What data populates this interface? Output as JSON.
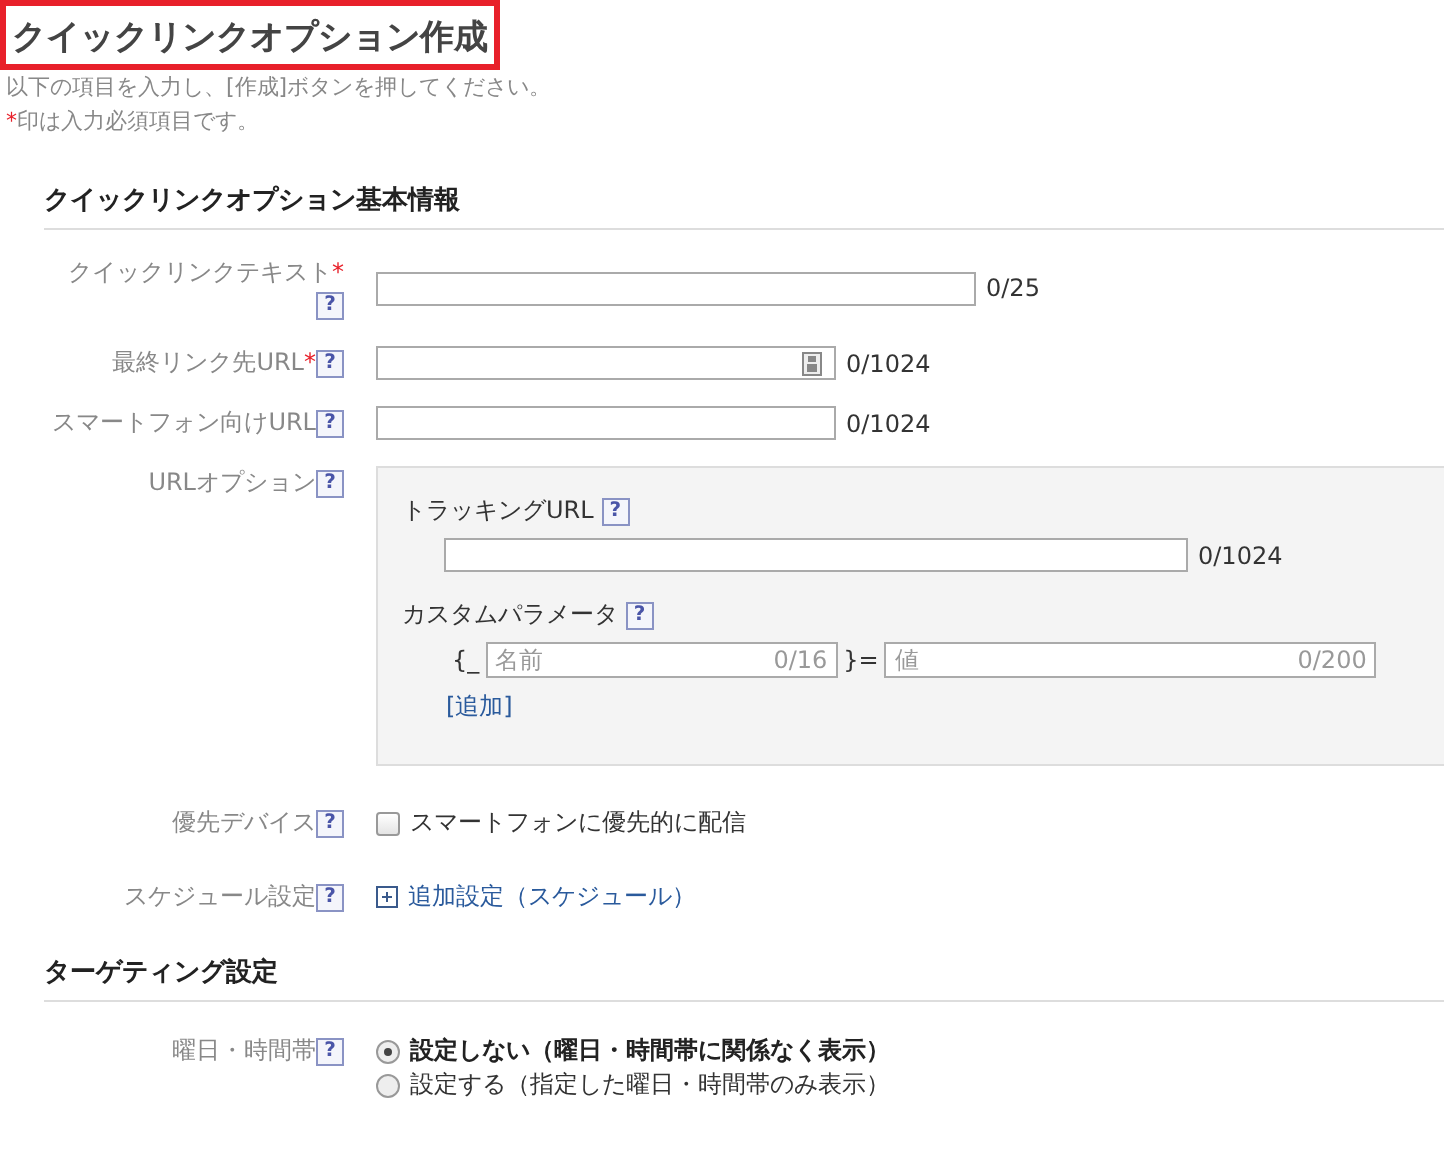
{
  "page": {
    "title": "クイックリンクオプション作成",
    "title_highlighted": true,
    "instructions": "以下の項目を入力し、[作成]ボタンを押してください。",
    "required_note": "印は入力必須項目です。",
    "required_mark": "*"
  },
  "sections": [
    {
      "heading": "クイックリンクオプション基本情報",
      "rows": [
        {
          "kind": "text",
          "label": "クイックリンクテキスト",
          "required": true,
          "help": "?",
          "counter": "0/25",
          "wide": true,
          "field_icon": false
        },
        {
          "kind": "text",
          "label": "最終リンク先URL",
          "required": true,
          "help": "?",
          "counter": "0/1024",
          "wide": false,
          "field_icon": true
        },
        {
          "kind": "text",
          "label": "スマートフォン向けURL",
          "required": false,
          "help": "?",
          "counter": "0/1024",
          "wide": false,
          "field_icon": false
        },
        {
          "kind": "url_options",
          "label": "URLオプション",
          "required": false,
          "help": "?",
          "tracking": {
            "label": "トラッキングURL",
            "help": "?",
            "counter": "0/1024"
          },
          "custom": {
            "label": "カスタムパラメータ",
            "help": "?",
            "open": "{_",
            "name_placeholder": "名前",
            "name_counter": "0/16",
            "equals": "}=",
            "value_placeholder": "値",
            "value_counter": "0/200",
            "add_link": "[追加]"
          }
        },
        {
          "kind": "checkbox",
          "label": "優先デバイス",
          "required": false,
          "help": "?",
          "option": "スマートフォンに優先的に配信",
          "checked": false
        },
        {
          "kind": "expander",
          "label": "スケジュール設定",
          "required": false,
          "help": "?",
          "link": "追加設定（スケジュール）",
          "expanded": false
        }
      ]
    },
    {
      "heading": "ターゲティング設定",
      "rows": [
        {
          "kind": "radio",
          "label": "曜日・時間帯",
          "required": false,
          "help": "?",
          "options": [
            {
              "label": "設定しない（曜日・時間帯に関係なく表示）",
              "selected": true
            },
            {
              "label": "設定する（指定した曜日・時間帯のみ表示）",
              "selected": false
            }
          ]
        }
      ]
    }
  ]
}
